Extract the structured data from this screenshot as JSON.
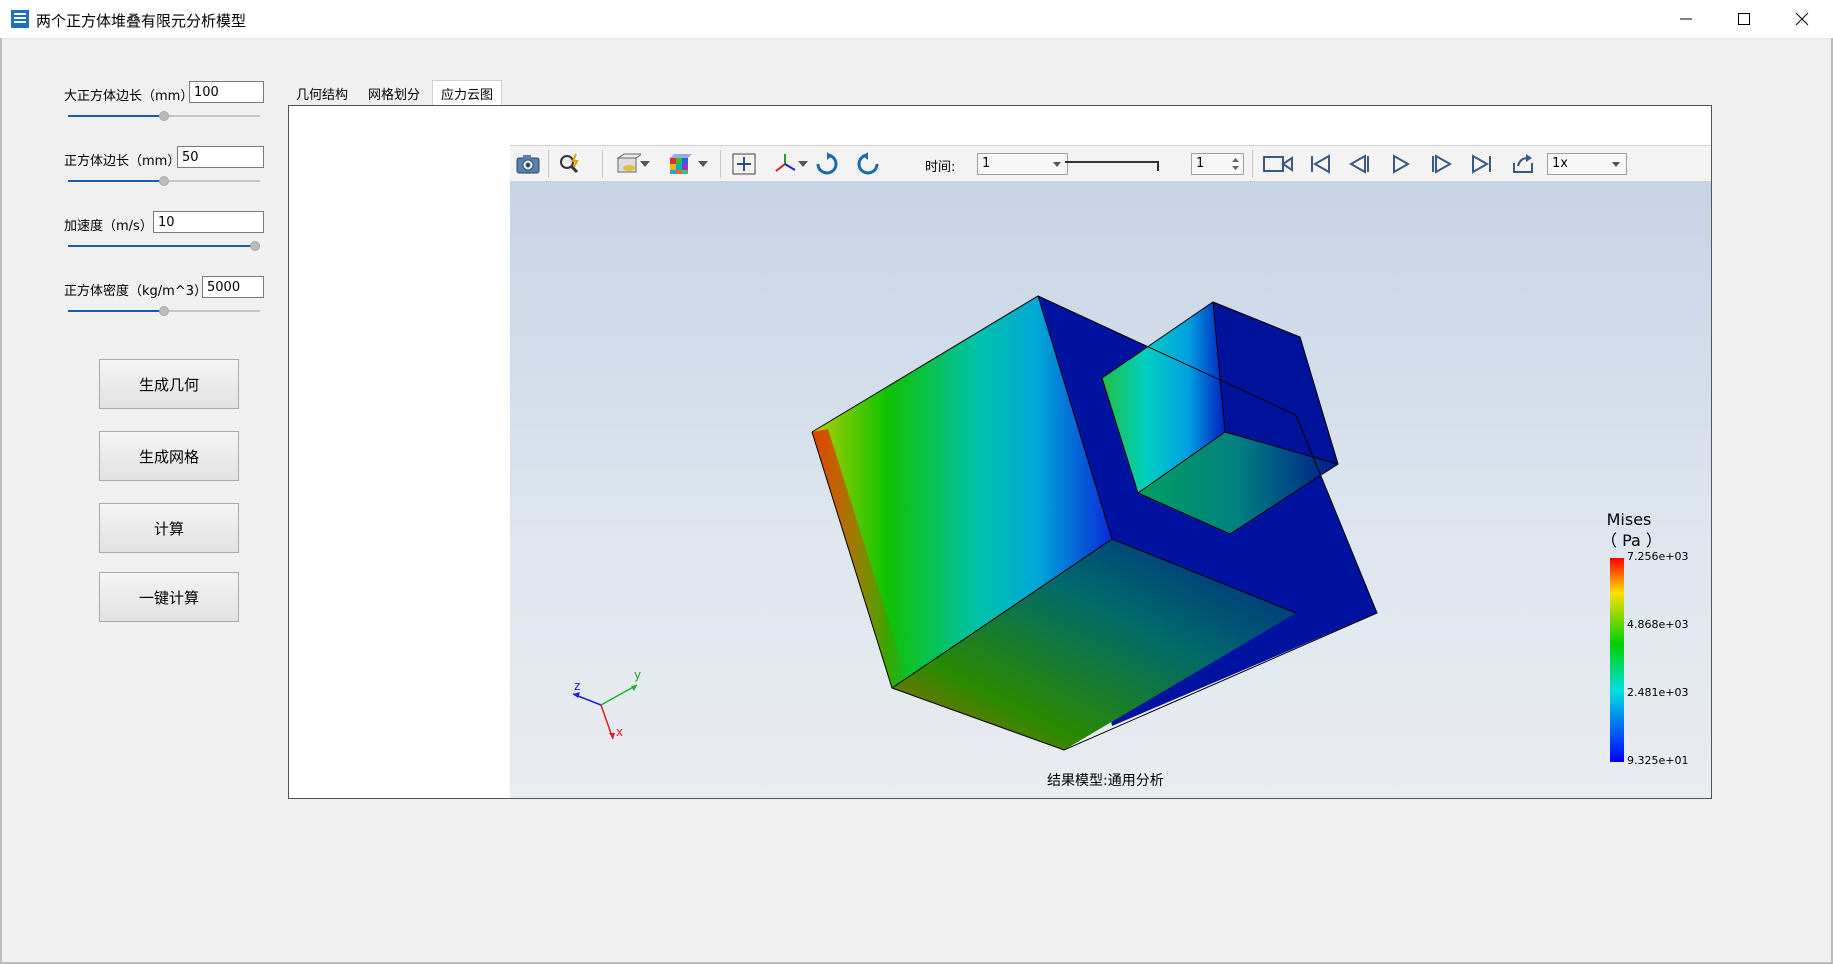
{
  "window": {
    "title": "两个正方体堆叠有限元分析模型",
    "icon": "app-icon"
  },
  "params": [
    {
      "label": "大正方体边长（mm）",
      "value": "100",
      "slider_fraction": 0.5
    },
    {
      "label": "正方体边长（mm）",
      "value": "50",
      "slider_fraction": 0.5
    },
    {
      "label": "加速度（m/s）",
      "value": "10",
      "slider_fraction": 1.0
    },
    {
      "label": "正方体密度（kg/m^3）",
      "value": "5000",
      "slider_fraction": 0.5
    }
  ],
  "buttons": {
    "generate_geometry": "生成几何",
    "generate_mesh": "生成网格",
    "compute": "计算",
    "one_click": "一键计算"
  },
  "tabs": [
    {
      "label": "几何结构",
      "active": false
    },
    {
      "label": "网格划分",
      "active": false
    },
    {
      "label": "应力云图",
      "active": true
    }
  ],
  "toolbar": {
    "time_label": "时间:",
    "time_value": "1",
    "frame_value": "1",
    "speed_value": "1x",
    "icons": [
      "camera-icon",
      "zoom-icon",
      "section-view-icon",
      "colormap-icon",
      "fit-view-icon",
      "axes-icon",
      "rotate-cw-icon",
      "rotate-ccw-icon",
      "record-icon",
      "first-frame-icon",
      "prev-frame-icon",
      "play-icon",
      "next-frame-icon",
      "last-frame-icon",
      "export-icon"
    ]
  },
  "legend": {
    "title": "Mises",
    "unit": "（ Pa ）",
    "ticks": [
      "7.256e+03",
      "4.868e+03",
      "2.481e+03",
      "9.325e+01"
    ]
  },
  "axes": {
    "x": "x",
    "y": "y",
    "z": "z"
  },
  "footer": "结果模型:通用分析"
}
